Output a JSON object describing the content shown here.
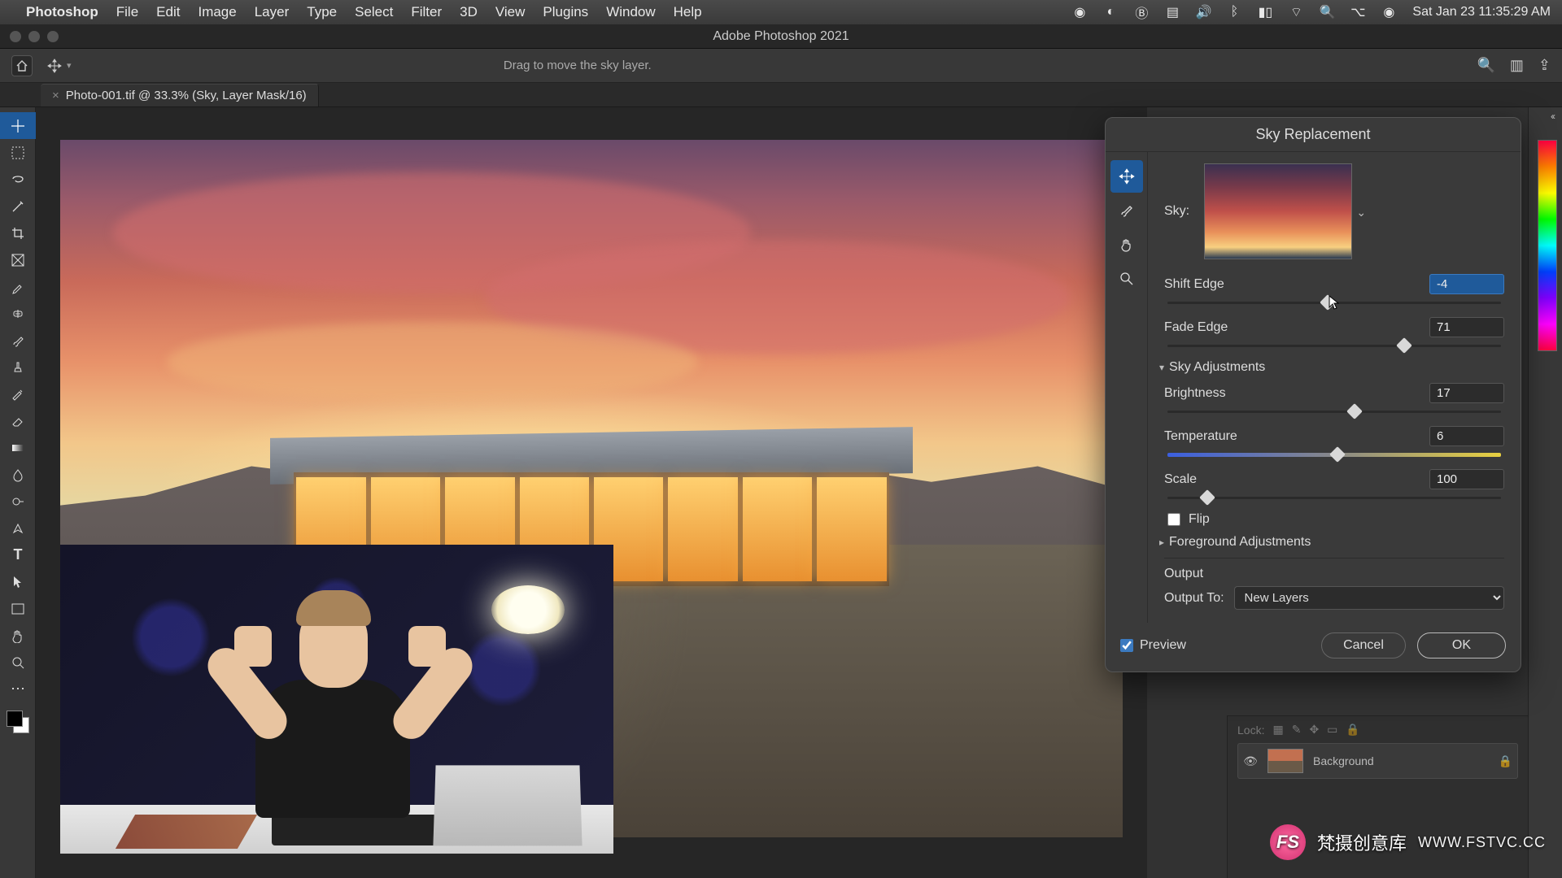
{
  "menubar": {
    "app": "Photoshop",
    "items": [
      "File",
      "Edit",
      "Image",
      "Layer",
      "Type",
      "Select",
      "Filter",
      "3D",
      "View",
      "Plugins",
      "Window",
      "Help"
    ],
    "clock": "Sat Jan 23  11:35:29 AM"
  },
  "window": {
    "title": "Adobe Photoshop 2021"
  },
  "toolbar": {
    "hint": "Drag to move the sky layer."
  },
  "doc_tab": {
    "label": "Photo-001.tif @ 33.3% (Sky, Layer Mask/16)"
  },
  "layers": {
    "lock_label": "Lock:",
    "bg_name": "Background"
  },
  "dialog": {
    "title": "Sky Replacement",
    "sky_label": "Sky:",
    "shift_edge": {
      "label": "Shift Edge",
      "value": "-4",
      "pos": 48
    },
    "fade_edge": {
      "label": "Fade Edge",
      "value": "71",
      "pos": 71
    },
    "section_adjust": "Sky Adjustments",
    "brightness": {
      "label": "Brightness",
      "value": "17",
      "pos": 56
    },
    "temperature": {
      "label": "Temperature",
      "value": "6",
      "pos": 51
    },
    "scale": {
      "label": "Scale",
      "value": "100",
      "pos": 12
    },
    "flip_label": "Flip",
    "section_fg": "Foreground Adjustments",
    "output_hdr": "Output",
    "output_to_label": "Output To:",
    "output_to_value": "New Layers",
    "preview_label": "Preview",
    "cancel": "Cancel",
    "ok": "OK"
  },
  "watermark": {
    "badge": "FS",
    "text": "梵摄创意库",
    "url": "WWW.FSTVC.CC"
  }
}
